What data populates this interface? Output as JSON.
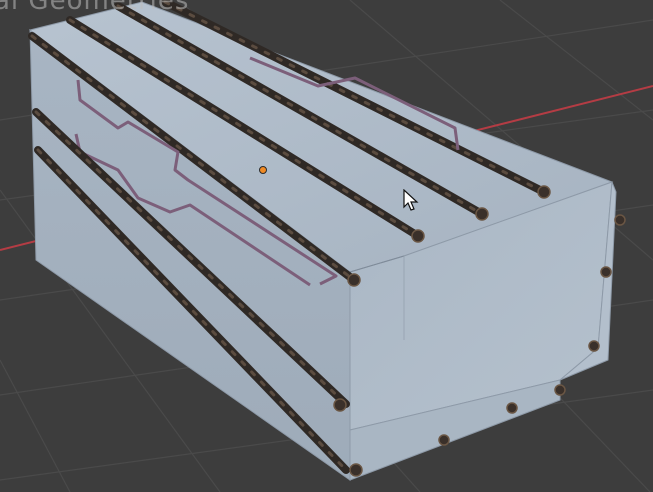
{
  "viewport": {
    "overlay_label": "al Geometries",
    "background_color": "#3d3d3d",
    "grid_color": "#4a4a4a",
    "x_axis_color": "#b43c44"
  },
  "object": {
    "name": "",
    "shape": "rectangular box beam with rebar cage",
    "face_color": "#a9b6c4",
    "edge_color": "#8e9aa8",
    "rebar_color": "#3c3430",
    "stirrup_color": "#8b6d8c"
  },
  "icons": {
    "origin": "origin-dot-icon",
    "cursor": "mouse-cursor-icon"
  }
}
